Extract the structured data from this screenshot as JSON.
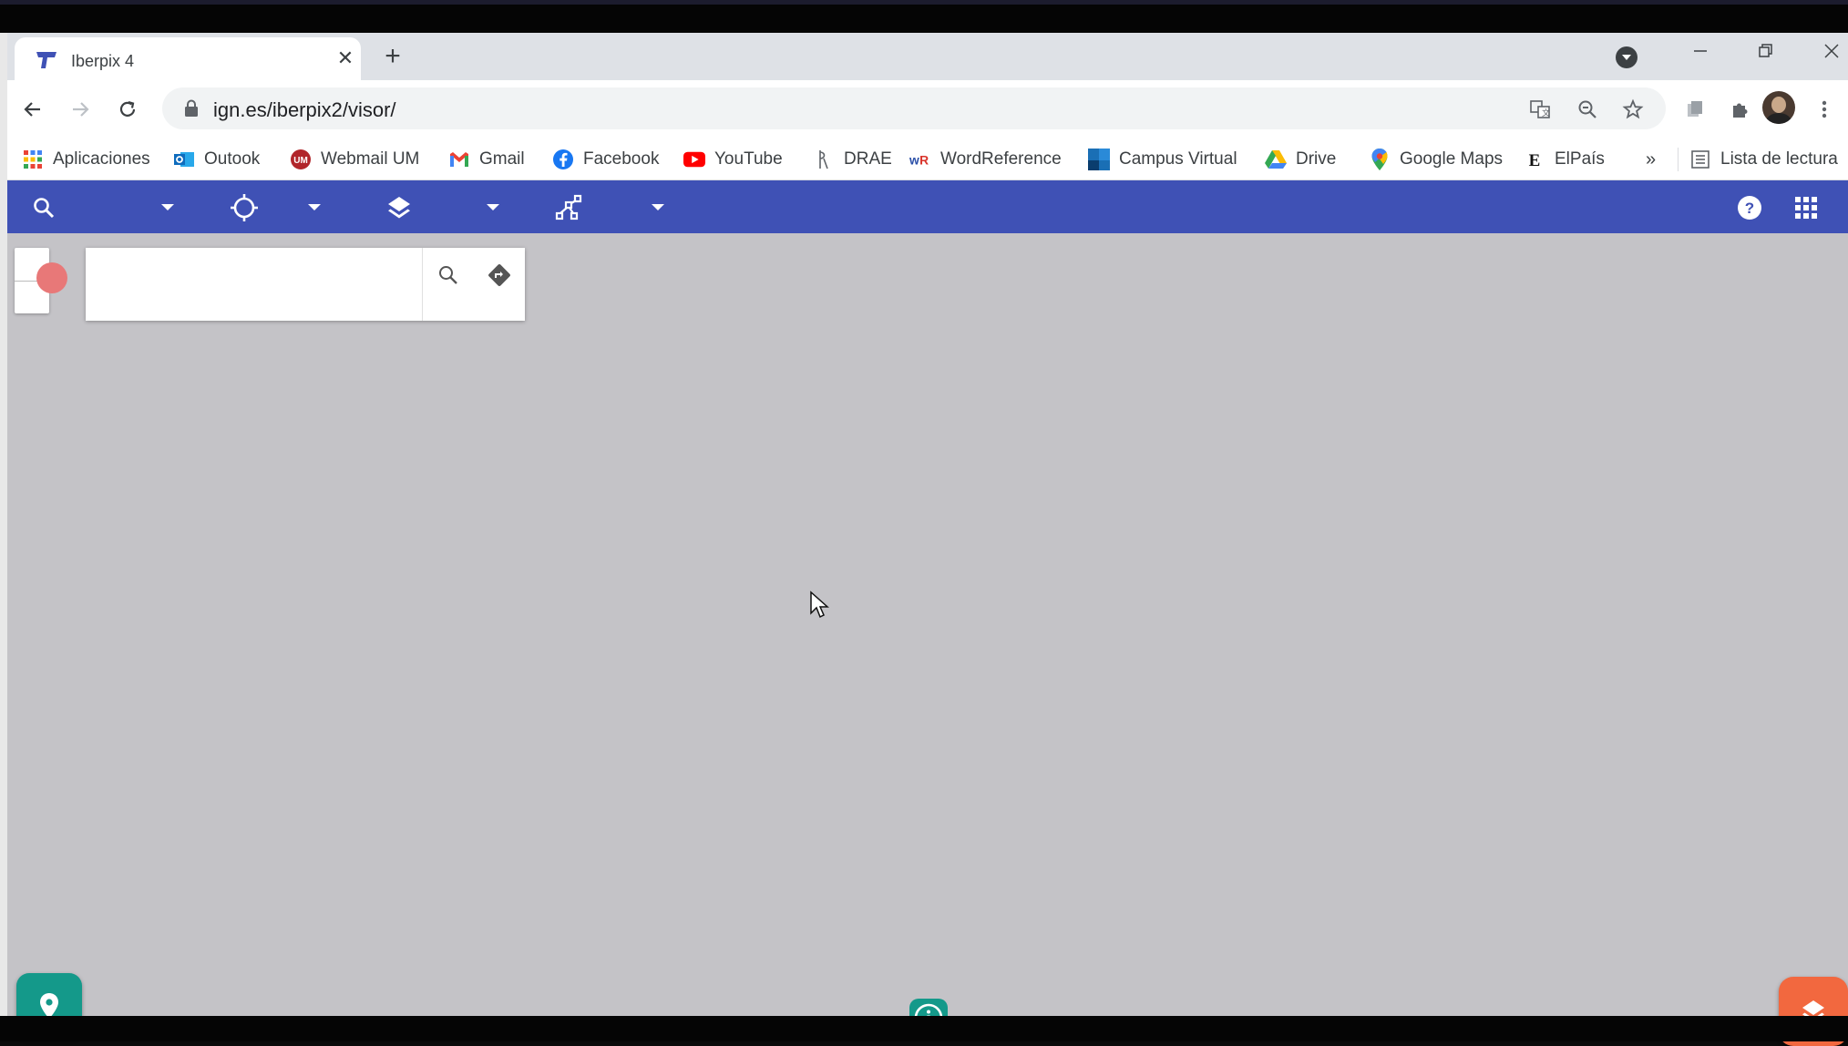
{
  "browser": {
    "tab": {
      "title": "Iberpix 4",
      "favicon": "ign-shield-icon",
      "close": "✕"
    },
    "new_tab": "+",
    "window_controls": {
      "minimize": "minimize-icon",
      "restore": "restore-icon",
      "close": "close-icon"
    },
    "address": {
      "url": "ign.es/iberpix2/visor/"
    },
    "bookmarks": [
      {
        "label": "Aplicaciones",
        "icon": "apps-grid-icon"
      },
      {
        "label": "Outook",
        "icon": "outlook-icon"
      },
      {
        "label": "Webmail UM",
        "icon": "um-icon"
      },
      {
        "label": "Gmail",
        "icon": "gmail-icon"
      },
      {
        "label": "Facebook",
        "icon": "facebook-icon"
      },
      {
        "label": "YouTube",
        "icon": "youtube-icon"
      },
      {
        "label": "DRAE",
        "icon": "drae-icon"
      },
      {
        "label": "WordReference",
        "icon": "wordreference-icon"
      },
      {
        "label": "Campus Virtual",
        "icon": "campus-virtual-icon"
      },
      {
        "label": "Drive",
        "icon": "drive-icon"
      },
      {
        "label": "Google Maps",
        "icon": "google-maps-icon"
      },
      {
        "label": "ElPaís",
        "icon": "elpais-icon"
      }
    ],
    "bookmarks_more": "»",
    "reading_list": "Lista de lectura"
  },
  "app": {
    "toolbar_tools": [
      "search-tool",
      "locate-tool",
      "layers-tool",
      "draw-tool"
    ],
    "search": {
      "placeholder": ""
    }
  },
  "colors": {
    "app_bar": "#3f51b5",
    "map_bg": "#c4c3c7",
    "fab_teal": "#14998a",
    "fab_orange": "#f2683f"
  }
}
